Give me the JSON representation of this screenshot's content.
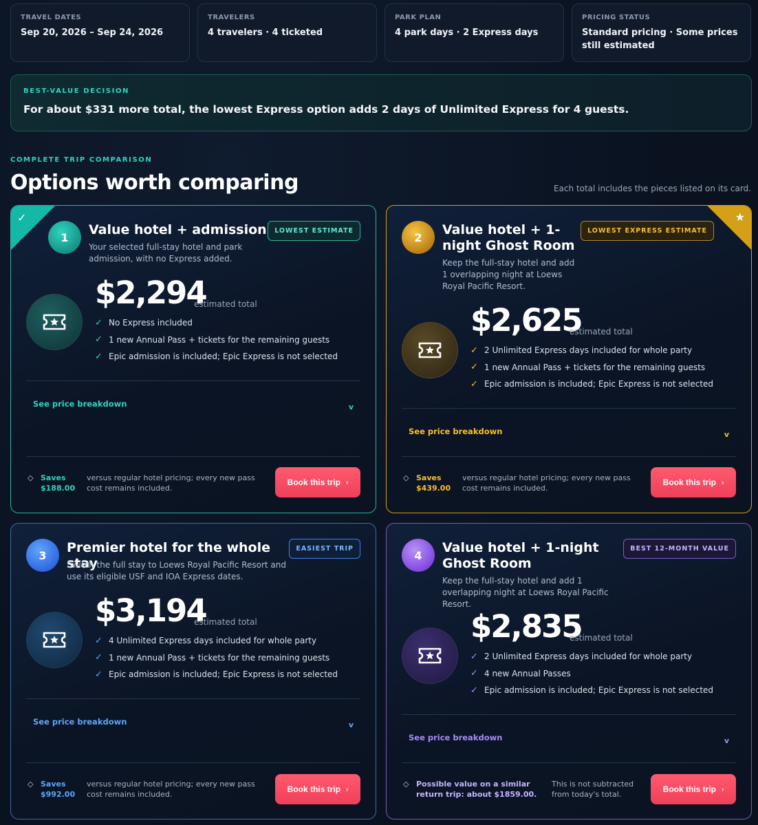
{
  "summary": [
    {
      "label": "TRAVEL DATES",
      "value": "Sep 20, 2026 – Sep 24, 2026"
    },
    {
      "label": "TRAVELERS",
      "value": "4 travelers · 4 ticketed"
    },
    {
      "label": "PARK PLAN",
      "value": "4 park days · 2 Express days"
    },
    {
      "label": "PRICING STATUS",
      "value": "Standard pricing · Some prices still estimated"
    }
  ],
  "decision": {
    "label": "BEST-VALUE DECISION",
    "text": "For about $331 more total, the lowest Express option adds 2 days of Unlimited Express for 4 guests."
  },
  "section": {
    "eyebrow": "COMPLETE TRIP COMPARISON",
    "title": "Options worth comparing",
    "note": "Each total includes the pieces listed on its card."
  },
  "icons": {
    "check": "check-icon",
    "star": "star-icon",
    "ticket": "ticket-icon",
    "diamond": "diamond-icon",
    "chevron": "chevron-down-icon"
  },
  "colors": {
    "teal": "#2dd4bf",
    "gold": "#fbbf24",
    "blue": "#60a5fa",
    "purple": "#a78bfa",
    "cta": "#f0405a"
  },
  "cards": [
    {
      "number": "1",
      "title": "Value hotel + admission",
      "description": "Your selected full-stay hotel and park admission, with no Express added.",
      "badge": "LOWEST ESTIMATE",
      "corner_mark": "✓",
      "price": "$2,294",
      "price_note": "estimated total",
      "features": [
        "No Express included",
        "1 new Annual Pass + tickets for the remaining guests",
        "Epic admission is included; Epic Express is not selected"
      ],
      "breakdown": "See price breakdown",
      "chevron": "v",
      "saves_label": "Saves",
      "saves_value": "$188.00",
      "saves_note": "versus regular hotel pricing; every new pass cost remains included.",
      "cta": "Book this trip",
      "cta_arrow": "›"
    },
    {
      "number": "2",
      "title": "Value hotel + 1-night Ghost Room",
      "description": "Keep the full-stay hotel and add 1 overlapping night at Loews Royal Pacific Resort.",
      "badge": "LOWEST EXPRESS ESTIMATE",
      "corner_mark": "★",
      "price": "$2,625",
      "price_note": "estimated total",
      "features": [
        "2 Unlimited Express days included for whole party",
        "1 new Annual Pass + tickets for the remaining guests",
        "Epic admission is included; Epic Express is not selected"
      ],
      "breakdown": "See price breakdown",
      "chevron": "v",
      "saves_label": "Saves",
      "saves_value": "$439.00",
      "saves_note": "versus regular hotel pricing; every new pass cost remains included.",
      "cta": "Book this trip",
      "cta_arrow": "›"
    },
    {
      "number": "3",
      "title": "Premier hotel for the whole stay",
      "description": "Switch the full stay to Loews Royal Pacific Resort and use its eligible USF and IOA Express dates.",
      "badge": "EASIEST TRIP",
      "price": "$3,194",
      "price_note": "estimated total",
      "features": [
        "4 Unlimited Express days included for whole party",
        "1 new Annual Pass + tickets for the remaining guests",
        "Epic admission is included; Epic Express is not selected"
      ],
      "breakdown": "See price breakdown",
      "chevron": "v",
      "saves_label": "Saves",
      "saves_value": "$992.00",
      "saves_note": "versus regular hotel pricing; every new pass cost remains included.",
      "cta": "Book this trip",
      "cta_arrow": "›"
    },
    {
      "number": "4",
      "title": "Value hotel + 1-night Ghost Room",
      "description": "Keep the full-stay hotel and add 1 overlapping night at Loews Royal Pacific Resort.",
      "badge": "BEST 12-MONTH VALUE",
      "price": "$2,835",
      "price_note": "estimated total",
      "features": [
        "2 Unlimited Express days included for whole party",
        "4 new Annual Passes",
        "Epic admission is included; Epic Express is not selected"
      ],
      "breakdown": "See price breakdown",
      "chevron": "v",
      "saves_label": "Possible value on a similar return trip: about $1859.00.",
      "saves_value": "",
      "saves_note": "This is not subtracted from today's total.",
      "cta": "Book this trip",
      "cta_arrow": "›"
    }
  ]
}
